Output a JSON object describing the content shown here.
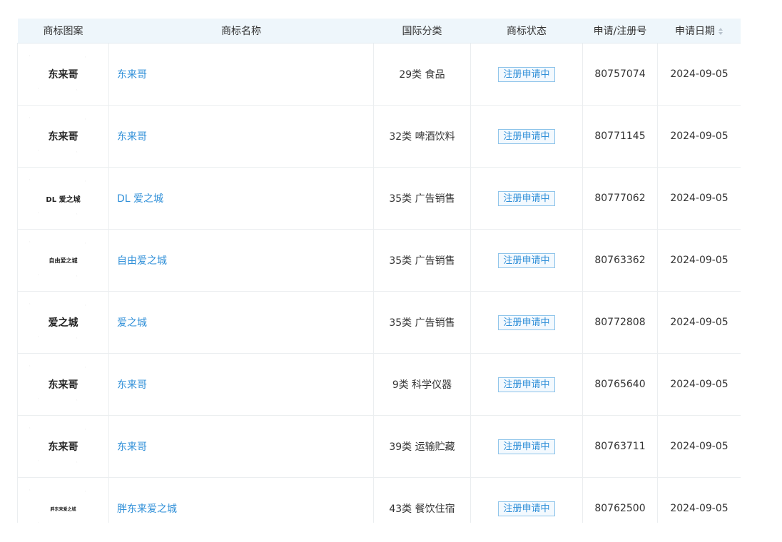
{
  "headers": {
    "logo": "商标图案",
    "name": "商标名称",
    "class": "国际分类",
    "status": "商标状态",
    "regno": "申请/注册号",
    "date": "申请日期"
  },
  "rows": [
    {
      "logo": "东来哥",
      "name": "东来哥",
      "class": "29类 食品",
      "status": "注册申请中",
      "regno": "80757074",
      "date": "2024-09-05"
    },
    {
      "logo": "东来哥",
      "name": "东来哥",
      "class": "32类 啤酒饮料",
      "status": "注册申请中",
      "regno": "80771145",
      "date": "2024-09-05"
    },
    {
      "logo": "DL 爱之城",
      "name": "DL 爱之城",
      "class": "35类 广告销售",
      "status": "注册申请中",
      "regno": "80777062",
      "date": "2024-09-05"
    },
    {
      "logo": "自由爱之城",
      "name": "自由爱之城",
      "class": "35类 广告销售",
      "status": "注册申请中",
      "regno": "80763362",
      "date": "2024-09-05"
    },
    {
      "logo": "爱之城",
      "name": "爱之城",
      "class": "35类 广告销售",
      "status": "注册申请中",
      "regno": "80772808",
      "date": "2024-09-05"
    },
    {
      "logo": "东来哥",
      "name": "东来哥",
      "class": "9类 科学仪器",
      "status": "注册申请中",
      "regno": "80765640",
      "date": "2024-09-05"
    },
    {
      "logo": "东来哥",
      "name": "东来哥",
      "class": "39类 运输贮藏",
      "status": "注册申请中",
      "regno": "80763711",
      "date": "2024-09-05"
    },
    {
      "logo": "胖东来爱之城",
      "name": "胖东来爱之城",
      "class": "43类 餐饮住宿",
      "status": "注册申请中",
      "regno": "80762500",
      "date": "2024-09-05"
    }
  ]
}
